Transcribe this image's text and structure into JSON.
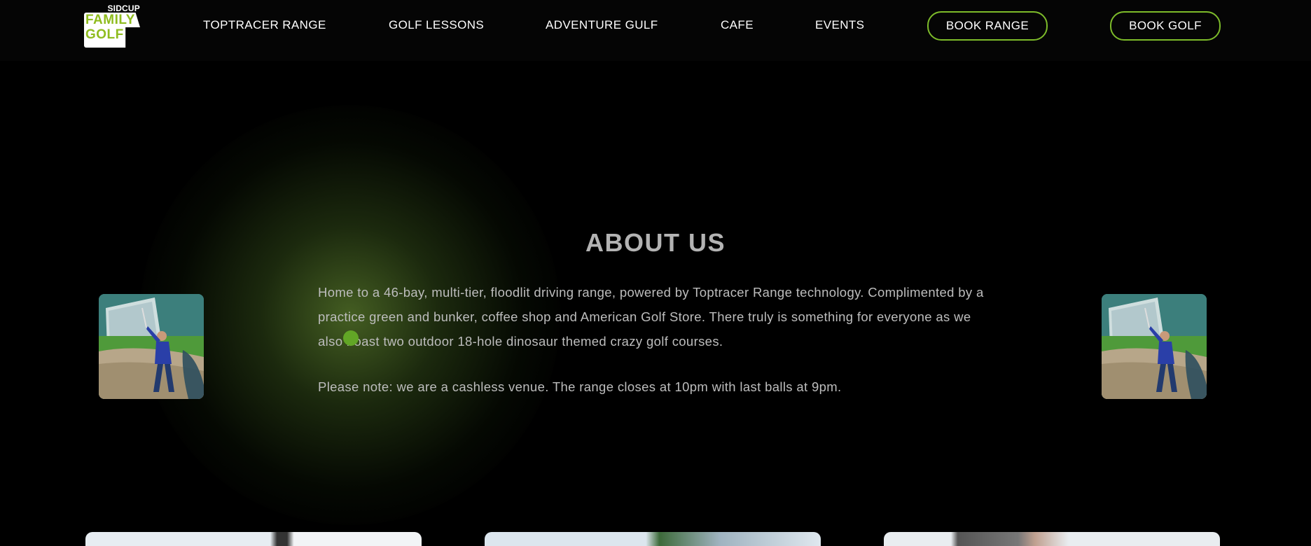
{
  "header": {
    "logo": {
      "top_text": "SIDCUP",
      "line1": "FAMILY",
      "line2": "GOLF",
      "brand_color": "#8fbc1e"
    },
    "nav": [
      {
        "label": "TOPTRACER RANGE"
      },
      {
        "label": "GOLF LESSONS"
      },
      {
        "label": "ADVENTURE GULF"
      },
      {
        "label": "CAFE"
      },
      {
        "label": "EVENTS"
      }
    ],
    "buttons": {
      "book_range": "BOOK RANGE",
      "book_golf": "BOOK GOLF"
    },
    "accent_color": "#7dbb2a"
  },
  "about": {
    "title": "ABOUT US",
    "paragraph": "Home to a 46-bay, multi-tier, floodlit driving range, powered by Toptracer Range technology. Complimented by a practice green and bunker, coffee shop and American Golf Store. There truly is something for everyone as we also boast two outdoor 18-hole dinosaur themed crazy golf courses.",
    "note": "Please note: we are a cashless venue. The range closes at 10pm with last balls at 9pm."
  }
}
